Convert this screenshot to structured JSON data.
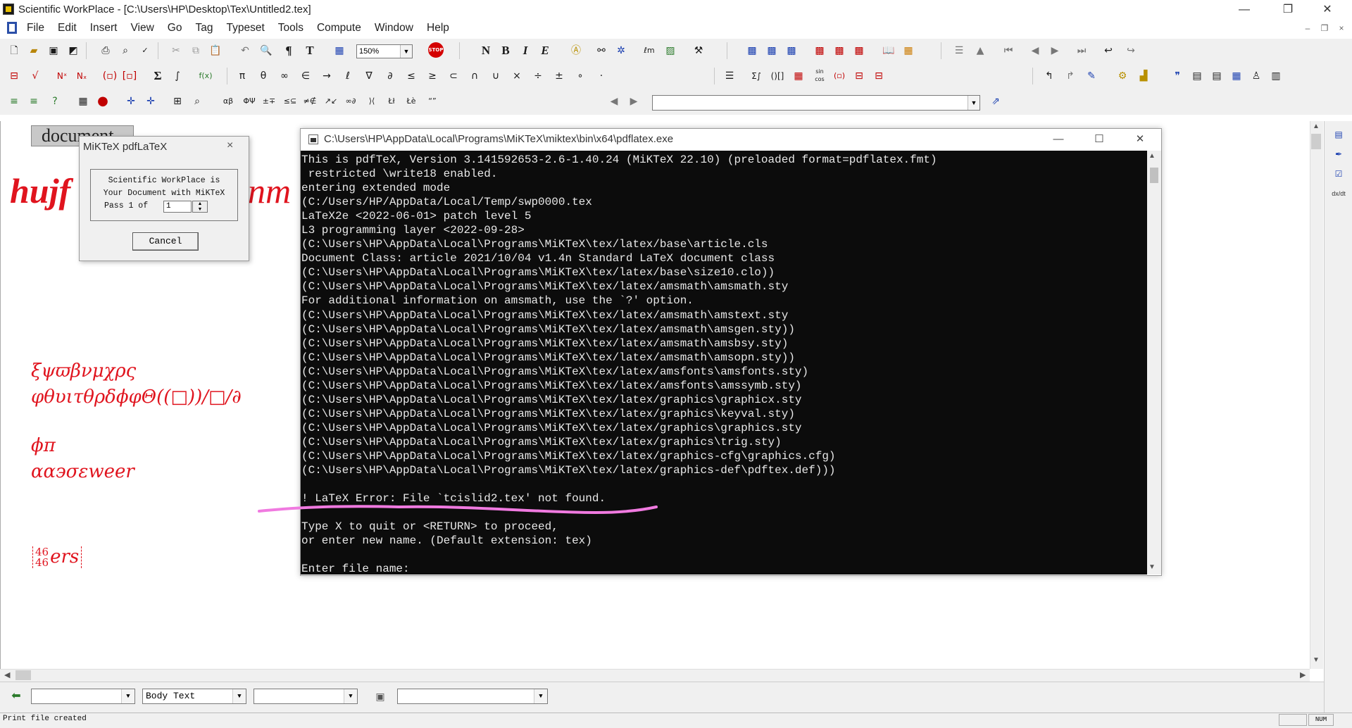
{
  "window": {
    "title": "Scientific WorkPlace - [C:\\Users\\HP\\Desktop\\Tex\\Untitled2.tex]",
    "minimize": "—",
    "restore": "❐",
    "close": "✕"
  },
  "menu": {
    "items": [
      "File",
      "Edit",
      "Insert",
      "View",
      "Go",
      "Tag",
      "Typeset",
      "Tools",
      "Compute",
      "Window",
      "Help"
    ],
    "mdi_min": "–",
    "mdi_restore": "❐",
    "mdi_close": "×"
  },
  "toolbar": {
    "zoom_value": "150%",
    "row1_text_buttons": [
      "N",
      "B",
      "I",
      "E"
    ],
    "row2_symbols": [
      "π",
      "θ",
      "∞",
      "∈",
      "→",
      "ℓ",
      "∇",
      "∂",
      "≤",
      "≥",
      "⊂",
      "∩",
      "∪",
      "×",
      "÷",
      "±",
      "∘",
      "·"
    ],
    "sum_label": "Σ",
    "integral_label": "∫"
  },
  "document": {
    "tab_label": "document",
    "heading_visible": "hujf",
    "heading_tail": "nm",
    "math_line1": "ξψϖβνμχρς",
    "math_line2": "φθυιτθρδϕφΘ((□))/□/∂",
    "math_line3": "ϕπ",
    "math_line4": "αα϶σεweer",
    "math_frac_num": "46",
    "math_frac_den": "46",
    "math_line5": "ers"
  },
  "miktex_dialog": {
    "title": "MiKTeX pdfLaTeX",
    "close": "×",
    "message_line1": "Scientific WorkPlace is",
    "message_line2": "Your Document with MiKTeX",
    "pass_label": "Pass 1 of",
    "pass_value": "1",
    "cancel_label": "Cancel"
  },
  "console": {
    "title": "C:\\Users\\HP\\AppData\\Local\\Programs\\MiKTeX\\miktex\\bin\\x64\\pdflatex.exe",
    "minimize": "—",
    "maximize": "☐",
    "close": "✕",
    "lines": [
      "This is pdfTeX, Version 3.141592653-2.6-1.40.24 (MiKTeX 22.10) (preloaded format=pdflatex.fmt)",
      " restricted \\write18 enabled.",
      "entering extended mode",
      "(C:/Users/HP/AppData/Local/Temp/swp0000.tex",
      "LaTeX2e <2022-06-01> patch level 5",
      "L3 programming layer <2022-09-28>",
      "(C:\\Users\\HP\\AppData\\Local\\Programs\\MiKTeX\\tex/latex/base\\article.cls",
      "Document Class: article 2021/10/04 v1.4n Standard LaTeX document class",
      "(C:\\Users\\HP\\AppData\\Local\\Programs\\MiKTeX\\tex/latex/base\\size10.clo))",
      "(C:\\Users\\HP\\AppData\\Local\\Programs\\MiKTeX\\tex/latex/amsmath\\amsmath.sty",
      "For additional information on amsmath, use the `?' option.",
      "(C:\\Users\\HP\\AppData\\Local\\Programs\\MiKTeX\\tex/latex/amsmath\\amstext.sty",
      "(C:\\Users\\HP\\AppData\\Local\\Programs\\MiKTeX\\tex/latex/amsmath\\amsgen.sty))",
      "(C:\\Users\\HP\\AppData\\Local\\Programs\\MiKTeX\\tex/latex/amsmath\\amsbsy.sty)",
      "(C:\\Users\\HP\\AppData\\Local\\Programs\\MiKTeX\\tex/latex/amsmath\\amsopn.sty))",
      "(C:\\Users\\HP\\AppData\\Local\\Programs\\MiKTeX\\tex/latex/amsfonts\\amsfonts.sty)",
      "(C:\\Users\\HP\\AppData\\Local\\Programs\\MiKTeX\\tex/latex/amsfonts\\amssymb.sty)",
      "(C:\\Users\\HP\\AppData\\Local\\Programs\\MiKTeX\\tex/latex/graphics\\graphicx.sty",
      "(C:\\Users\\HP\\AppData\\Local\\Programs\\MiKTeX\\tex/latex/graphics\\keyval.sty)",
      "(C:\\Users\\HP\\AppData\\Local\\Programs\\MiKTeX\\tex/latex/graphics\\graphics.sty",
      "(C:\\Users\\HP\\AppData\\Local\\Programs\\MiKTeX\\tex/latex/graphics\\trig.sty)",
      "(C:\\Users\\HP\\AppData\\Local\\Programs\\MiKTeX\\tex/latex/graphics-cfg\\graphics.cfg)",
      "(C:\\Users\\HP\\AppData\\Local\\Programs\\MiKTeX\\tex/latex/graphics-def\\pdftex.def)))",
      "",
      "! LaTeX Error: File `tcislid2.tex' not found.",
      "",
      "Type X to quit or <RETURN> to proceed,",
      "or enter new name. (Default extension: tex)",
      "",
      "Enter file name: "
    ]
  },
  "tagbar": {
    "combo1_value": "",
    "combo2_value": "Body Text",
    "combo3_value": "",
    "combo4_value": ""
  },
  "status": {
    "text": "Print file created",
    "num_indicator": "NUM"
  },
  "colors": {
    "document_math": "#e0141e",
    "annotation_stroke": "#f07ae0",
    "console_background": "#0c0c0c"
  }
}
